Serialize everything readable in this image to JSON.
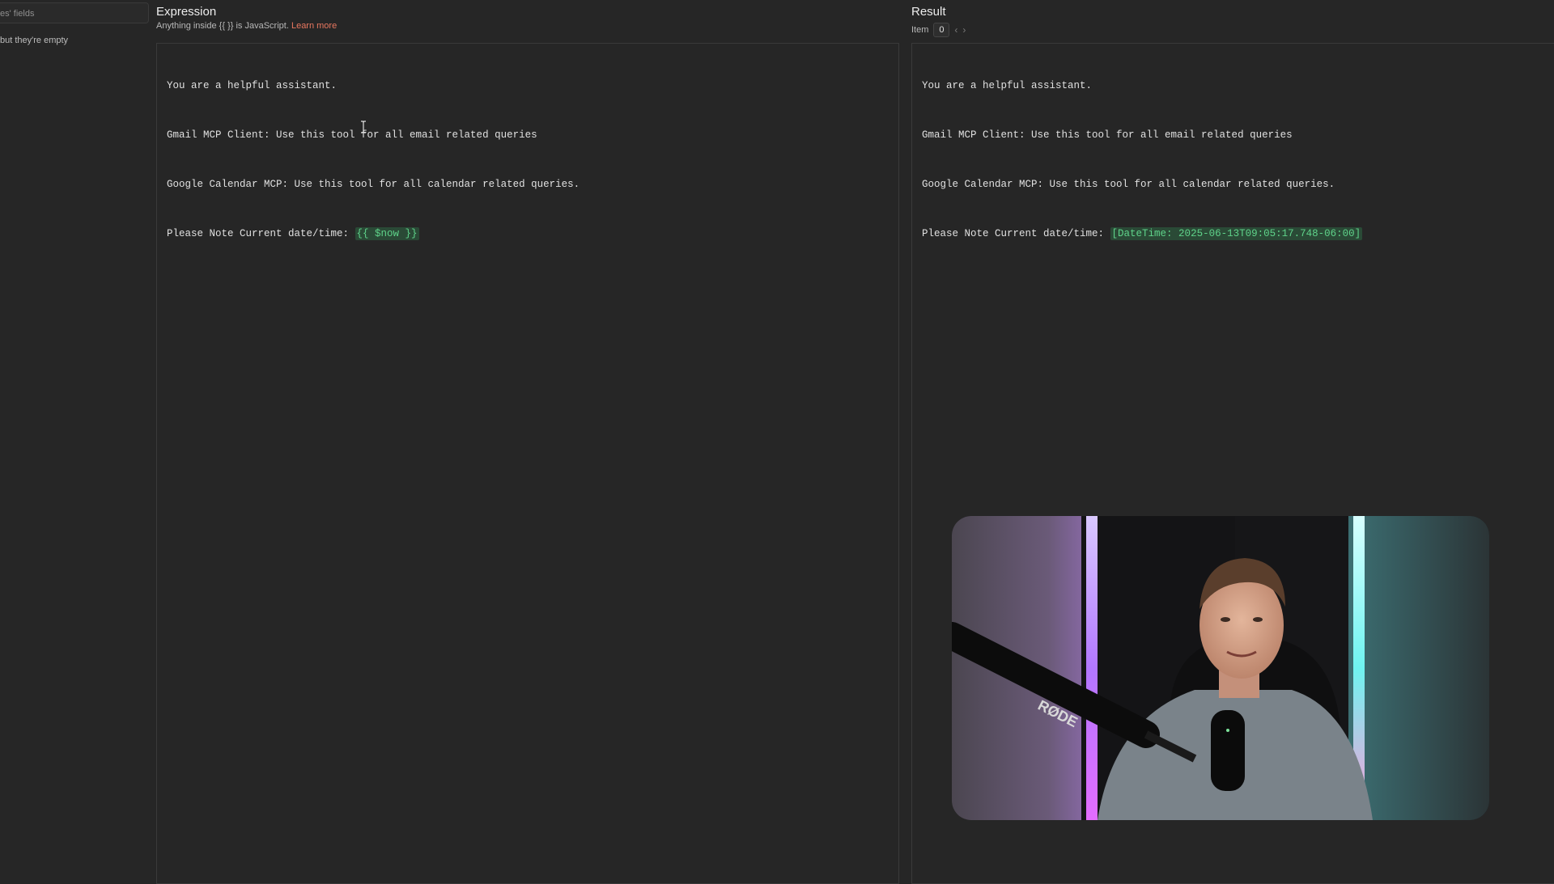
{
  "sidebar": {
    "search_placeholder": "es' fields",
    "note": "but they're empty"
  },
  "expression": {
    "title": "Expression",
    "hint_prefix": "Anything inside {{ }} is JavaScript.",
    "hint_link": "Learn more",
    "lines": [
      "You are a helpful assistant.",
      "Gmail MCP Client: Use this tool for all email related queries",
      "Google Calendar MCP: Use this tool for all calendar related queries."
    ],
    "last_line_prefix": "Please Note Current date/time: ",
    "last_line_expr": "{{ $now }}"
  },
  "result": {
    "title": "Result",
    "item_label": "Item",
    "item_value": "0",
    "lines": [
      "You are a helpful assistant.",
      "Gmail MCP Client: Use this tool for all email related queries",
      "Google Calendar MCP: Use this tool for all calendar related queries."
    ],
    "last_line_prefix": "Please Note Current date/time: ",
    "last_line_value": "[DateTime: 2025-06-13T09:05:17.748-06:00]"
  },
  "webcam": {
    "mic_brand": "RØDE"
  },
  "colors": {
    "background": "#262626",
    "link": "#e8775f",
    "highlight_bg": "#2a4a36",
    "highlight_fg": "#5fd38a"
  }
}
